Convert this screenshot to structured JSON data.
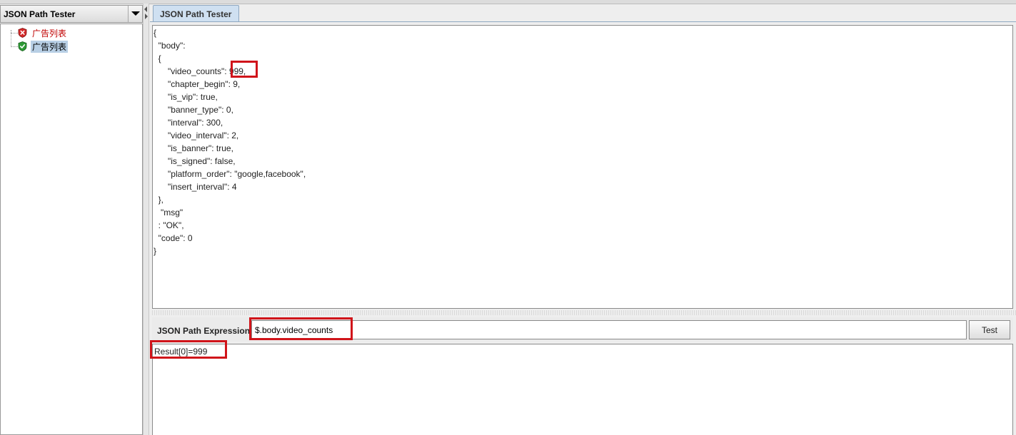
{
  "left_panel": {
    "title": "JSON Path Tester",
    "tree_items": [
      {
        "label": "广告列表",
        "status": "error",
        "icon": "red-shield-x-icon"
      },
      {
        "label": "广告列表",
        "status": "success",
        "icon": "green-shield-check-icon"
      }
    ]
  },
  "tab": {
    "label": "JSON Path Tester"
  },
  "json_text": [
    "{",
    "  \"body\":",
    "  {",
    "      \"video_counts\": 999,",
    "      \"chapter_begin\": 9,",
    "      \"is_vip\": true,",
    "      \"banner_type\": 0,",
    "      \"interval\": 300,",
    "      \"video_interval\": 2,",
    "      \"is_banner\": true,",
    "      \"is_signed\": false,",
    "      \"platform_order\": \"google,facebook\",",
    "      \"insert_interval\": 4",
    "  },",
    "   \"msg\"",
    "  : \"OK\",",
    "  \"code\": 0",
    "}"
  ],
  "expression": {
    "label": "JSON Path Expression",
    "value": "$.body.video_counts",
    "button_label": "Test"
  },
  "result": {
    "text": "Result[0]=999"
  },
  "colors": {
    "highlight": "#d0141a",
    "tab_bg": "#cfe0f1",
    "selected_item_bg": "#b8cfe5",
    "error_text": "#c00000"
  }
}
